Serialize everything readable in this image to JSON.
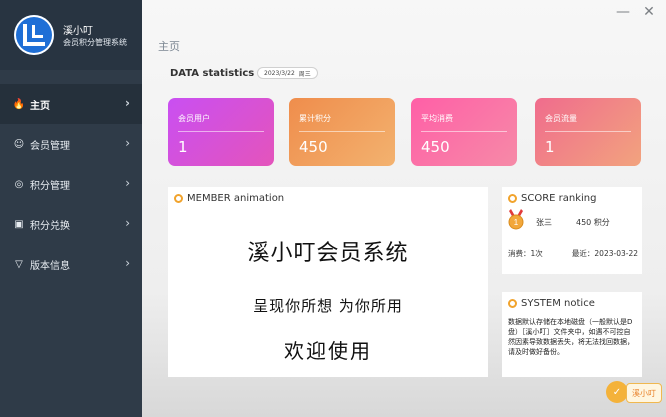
{
  "app": {
    "name": "溪小叮",
    "subtitle": "会员积分管理系统",
    "colors": {
      "sidebar": "#2f3b48",
      "sidebar_brand": "#283441",
      "accent": "#f1a32c",
      "logo": "#1f6fd6"
    }
  },
  "sidebar": {
    "items": [
      {
        "label": "主页",
        "icon": "fire-icon"
      },
      {
        "label": "会员管理",
        "icon": "members-icon"
      },
      {
        "label": "积分管理",
        "icon": "coin-icon"
      },
      {
        "label": "积分兑换",
        "icon": "gift-icon"
      },
      {
        "label": "版本信息",
        "icon": "version-icon"
      }
    ]
  },
  "window": {
    "minimize_glyph": "—",
    "close_glyph": "✕"
  },
  "header": {
    "page_title": "主页",
    "stats_title": "DATA statistics",
    "date": "2023/3/22",
    "weekday": "周三"
  },
  "stats": [
    {
      "label": "会员用户",
      "value": "1"
    },
    {
      "label": "累计积分",
      "value": "450"
    },
    {
      "label": "平均消费",
      "value": "450"
    },
    {
      "label": "会员流量",
      "value": "1"
    }
  ],
  "member_panel": {
    "title": "MEMBER animation",
    "line1": "溪小叮会员系统",
    "line2": "呈现你所想 为你所用",
    "line3": "欢迎使用"
  },
  "score_panel": {
    "title": "SCORE ranking",
    "name": "张三",
    "points": "450 积分",
    "consume": "消费：1次",
    "recent": "最近：2023-03-22"
  },
  "system_panel": {
    "title": "SYSTEM notice",
    "text": "数据默认存储在本地磁盘（一般默认是D盘）［溪小叮］文件夹中，如遇不可控自然因素导致数据丢失，将无法找回数据，请及时做好备份。"
  },
  "corner_logo": {
    "text": "溪小叮"
  }
}
